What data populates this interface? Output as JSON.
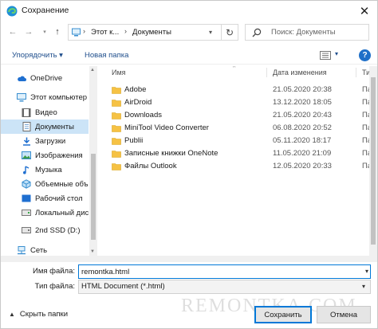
{
  "window": {
    "title": "Сохранение",
    "close_glyph": "✕"
  },
  "colors": {
    "accent": "#0078d7",
    "folder": "#f6c244",
    "selection": "#cce4f7",
    "help": "#1e6fc8"
  },
  "address": {
    "crumbs": [
      "Этот к...",
      "Документы"
    ],
    "separator": "›",
    "refresh_glyph": "↻"
  },
  "search": {
    "placeholder": "Поиск: Документы"
  },
  "toolbar": {
    "organize": "Упорядочить ▾",
    "new_folder": "Новая папка",
    "help": "?"
  },
  "sidebar": {
    "items": [
      {
        "label": "OneDrive",
        "icon": "cloud-icon"
      },
      {
        "label": "Этот компьютер",
        "icon": "computer-icon"
      },
      {
        "label": "Видео",
        "icon": "video-icon"
      },
      {
        "label": "Документы",
        "icon": "documents-icon"
      },
      {
        "label": "Загрузки",
        "icon": "download-icon"
      },
      {
        "label": "Изображения",
        "icon": "images-icon"
      },
      {
        "label": "Музыка",
        "icon": "music-icon"
      },
      {
        "label": "Объемные объ",
        "icon": "3d-objects-icon"
      },
      {
        "label": "Рабочий стол",
        "icon": "desktop-icon"
      },
      {
        "label": "Локальный дис",
        "icon": "drive-icon"
      },
      {
        "label": "2nd SSD (D:)",
        "icon": "drive-icon"
      },
      {
        "label": "Сеть",
        "icon": "network-icon"
      }
    ]
  },
  "columns": {
    "name": "Имя",
    "date": "Дата изменения",
    "type": "Тип"
  },
  "files": [
    {
      "name": "Adobe",
      "date": "21.05.2020 20:38",
      "type": "Папка"
    },
    {
      "name": "AirDroid",
      "date": "13.12.2020 18:05",
      "type": "Папка"
    },
    {
      "name": "Downloads",
      "date": "21.05.2020 20:43",
      "type": "Папка"
    },
    {
      "name": "MiniTool Video Converter",
      "date": "06.08.2020 20:52",
      "type": "Папка"
    },
    {
      "name": "Publii",
      "date": "05.11.2020 18:17",
      "type": "Папка"
    },
    {
      "name": "Записные книжки OneNote",
      "date": "11.05.2020 21:09",
      "type": "Папка"
    },
    {
      "name": "Файлы Outlook",
      "date": "12.05.2020 20:33",
      "type": "Папка"
    }
  ],
  "form": {
    "filename_label": "Имя файла:",
    "filename_value": "remontka.html",
    "filetype_label": "Тип файла:",
    "filetype_value": "HTML Document (*.html)"
  },
  "footer": {
    "hide_folders": "Скрыть папки",
    "save": "Сохранить",
    "cancel": "Отмена",
    "watermark": "REMONTKA.COM"
  }
}
